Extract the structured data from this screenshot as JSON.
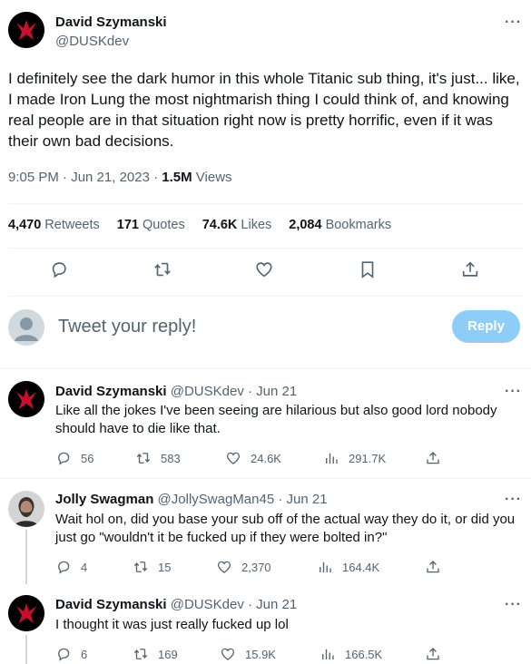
{
  "main_tweet": {
    "name": "David Szymanski",
    "handle": "@DUSKdev",
    "text": "I definitely see the dark humor in this whole Titanic sub thing, it's just... like, I made Iron Lung the most nightmarish thing I could think of, and knowing real people are in that situation right now is pretty horrific, even if it was their own bad decisions.",
    "time": "9:05 PM · Jun 21, 2023 · ",
    "views_count": "1.5M",
    "views_label": " Views",
    "more": "···"
  },
  "stats": {
    "retweets_count": "4,470",
    "retweets_label": "Retweets",
    "quotes_count": "171",
    "quotes_label": "Quotes",
    "likes_count": "74.6K",
    "likes_label": "Likes",
    "bookmarks_count": "2,084",
    "bookmarks_label": "Bookmarks"
  },
  "reply_box": {
    "placeholder": "Tweet your reply!",
    "button": "Reply"
  },
  "replies": [
    {
      "name": "David Szymanski",
      "handle_date": "@DUSKdev · Jun 21",
      "text": "Like all the jokes I've been seeing are hilarious but also good lord nobody should have to die like that.",
      "replies": "56",
      "retweets": "583",
      "likes": "24.6K",
      "views": "291.7K"
    },
    {
      "name": "Jolly Swagman",
      "handle_date": "@JollySwagMan45 · Jun 21",
      "text": "Wait hol on, did you base your sub off of the actual way they do it, or did you just go \"wouldn't it be fucked up if they were bolted in?\"",
      "replies": "4",
      "retweets": "15",
      "likes": "2,370",
      "views": "164.4K"
    },
    {
      "name": "David Szymanski",
      "handle_date": "@DUSKdev · Jun 21",
      "text": "I thought it was just really fucked up lol",
      "replies": "6",
      "retweets": "169",
      "likes": "15.9K",
      "views": "166.5K"
    }
  ],
  "colors": {
    "accent_disabled": "#8ecdf8",
    "muted": "#536471",
    "divider": "#eff3f4"
  },
  "icons": [
    "reply-icon",
    "retweet-icon",
    "like-icon",
    "bookmark-icon",
    "share-icon",
    "views-icon"
  ]
}
